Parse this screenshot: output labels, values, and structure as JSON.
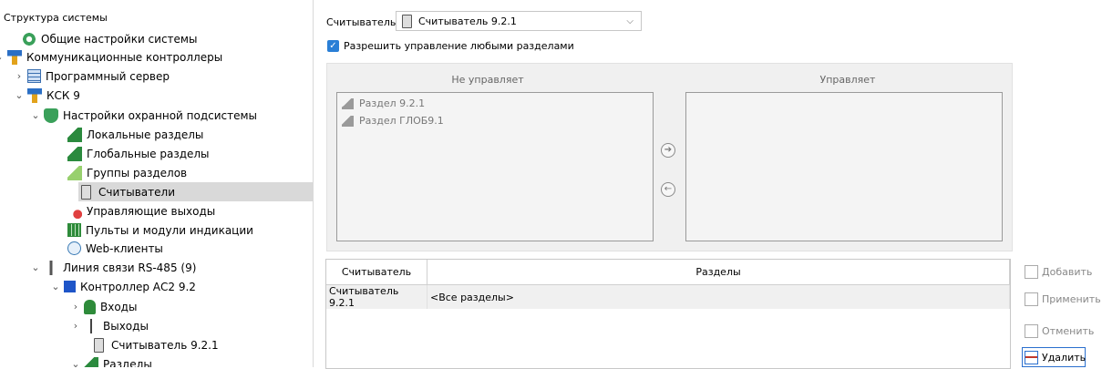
{
  "tree": {
    "title": "Структура системы",
    "items": [
      {
        "label": "Общие настройки системы",
        "icon": "settings-gear-icon"
      },
      {
        "label": "Коммуникационные контроллеры",
        "icon": "network-icon",
        "toggle": "⌄"
      },
      {
        "label": "Программный сервер",
        "icon": "server-icon",
        "toggle": "›"
      },
      {
        "label": "КСК 9",
        "icon": "network-icon",
        "toggle": "⌄"
      },
      {
        "label": "Настройки охранной подсистемы",
        "icon": "shield-icon",
        "toggle": "⌄"
      },
      {
        "label": "Локальные разделы",
        "icon": "local-sections-icon"
      },
      {
        "label": "Глобальные разделы",
        "icon": "global-sections-icon"
      },
      {
        "label": "Группы разделов",
        "icon": "section-groups-icon"
      },
      {
        "label": "Считыватели",
        "icon": "reader-icon"
      },
      {
        "label": "Управляющие выходы",
        "icon": "control-output-icon"
      },
      {
        "label": "Пульты и модули индикации",
        "icon": "panel-grid-icon"
      },
      {
        "label": "Web-клиенты",
        "icon": "web-globe-icon"
      },
      {
        "label": "Линия связи RS-485 (9)",
        "icon": "comm-line-icon",
        "toggle": "⌄"
      },
      {
        "label": "Контроллер АС2 9.2",
        "icon": "controller-icon",
        "toggle": "⌄"
      },
      {
        "label": "Входы",
        "icon": "bell-icon",
        "toggle": "›"
      },
      {
        "label": "Выходы",
        "icon": "outputs-icon",
        "toggle": "›"
      },
      {
        "label": "Считыватель 9.2.1",
        "icon": "reader-icon"
      },
      {
        "label": "Разделы",
        "icon": "sections-icon",
        "toggle": "⌄"
      }
    ],
    "selected_index": 8
  },
  "reader_select": {
    "label": "Считыватель:",
    "value": "Считыватель 9.2.1"
  },
  "allow_checkbox": {
    "label": "Разрешить управление любыми разделами",
    "checked": true
  },
  "groups": {
    "not_managed": {
      "header": "Не управляет",
      "items": [
        "Раздел 9.2.1",
        "Раздел  ГЛОБ9.1"
      ]
    },
    "managed": {
      "header": "Управляет",
      "items": []
    }
  },
  "transfer": {
    "right_glyph": "➔",
    "left_glyph": "←"
  },
  "table": {
    "columns": [
      "Считыватель",
      "Разделы"
    ],
    "rows": [
      [
        "Считыватель 9.2.1",
        "<Все разделы>"
      ]
    ]
  },
  "buttons": {
    "add": "Добавить",
    "apply": "Применить",
    "cancel": "Отменить",
    "delete": "Удалить"
  },
  "colors": {
    "accent": "#2a7fd6",
    "selected_row": "#d9d9d9",
    "panel": "#f0f0f0"
  }
}
